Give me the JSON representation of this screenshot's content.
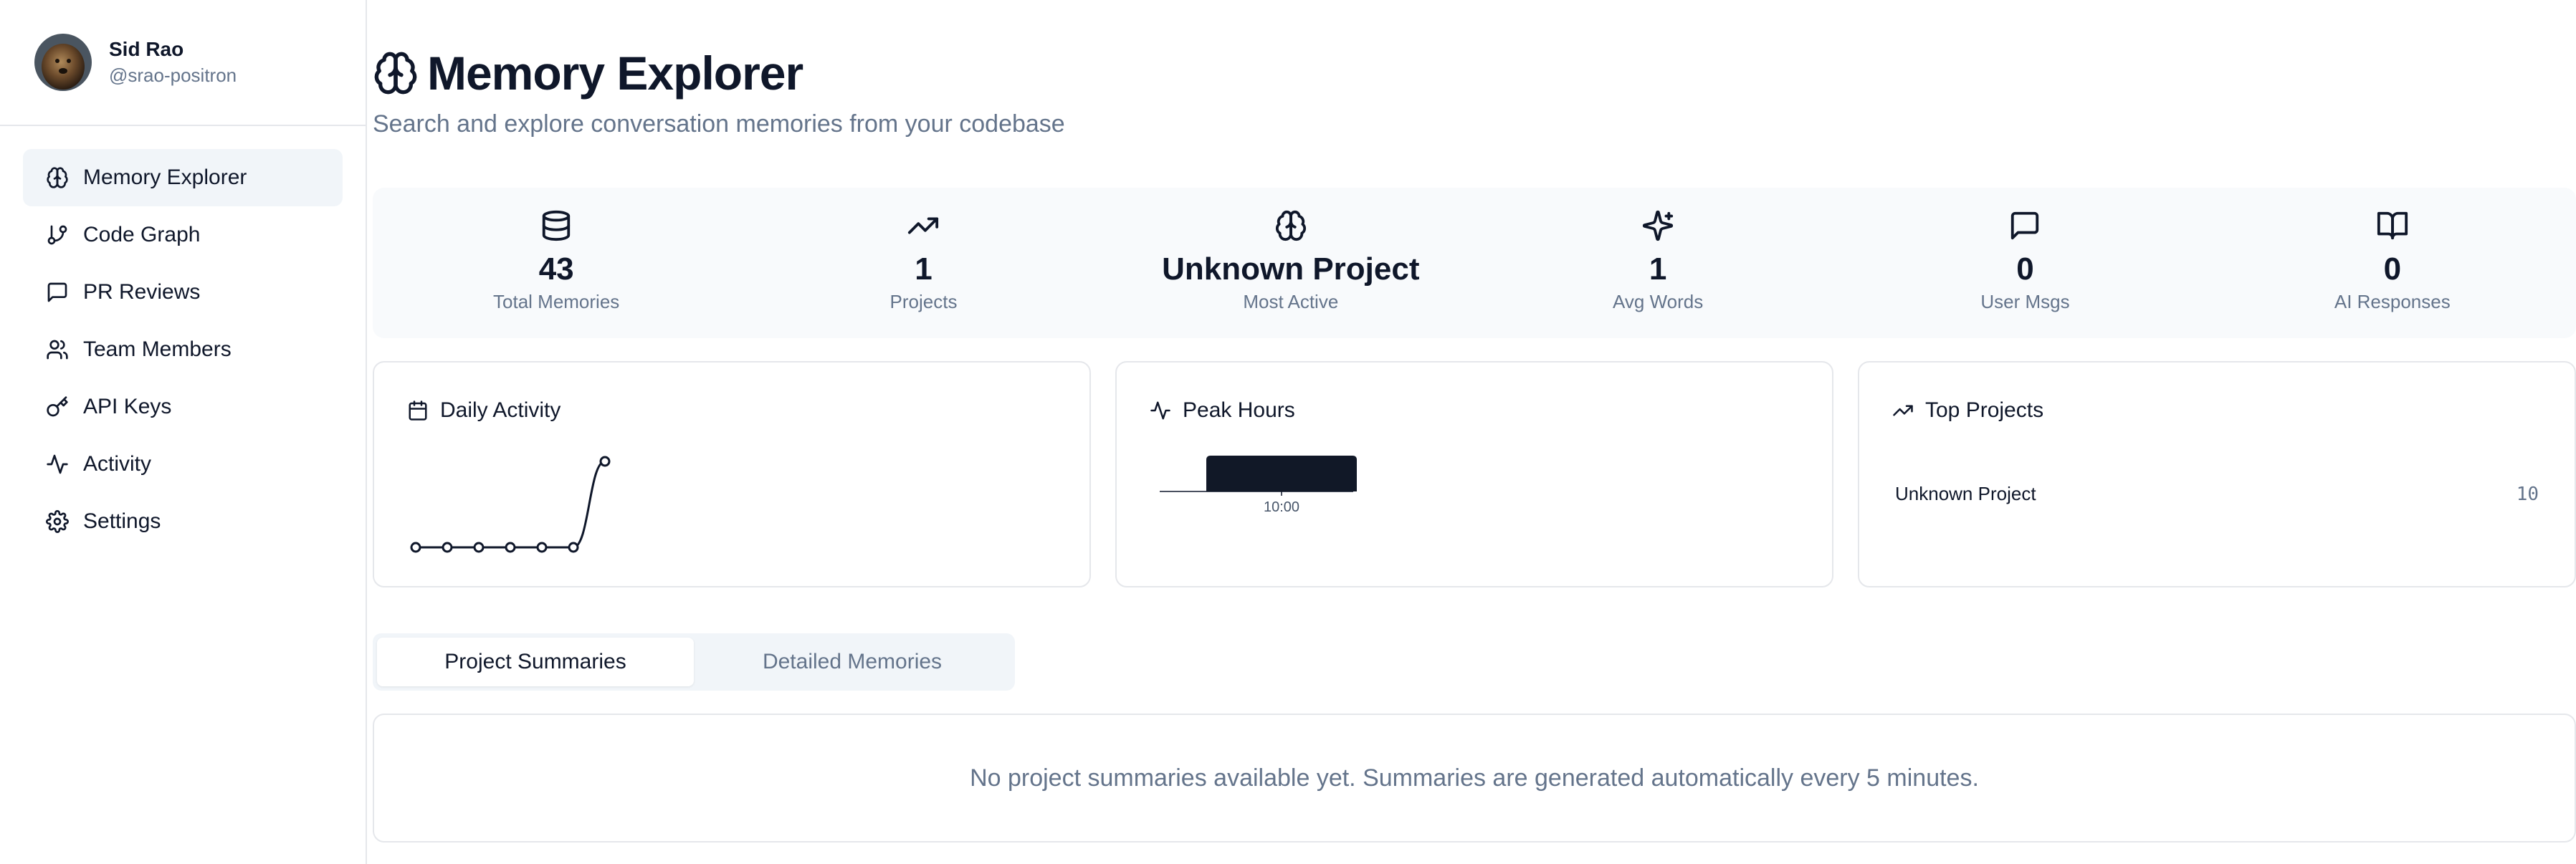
{
  "user": {
    "name": "Sid Rao",
    "handle": "@srao-positron"
  },
  "nav": [
    {
      "label": "Memory Explorer",
      "icon": "brain-icon",
      "active": true
    },
    {
      "label": "Code Graph",
      "icon": "git-branch-icon"
    },
    {
      "label": "PR Reviews",
      "icon": "message-square-icon"
    },
    {
      "label": "Team Members",
      "icon": "users-icon"
    },
    {
      "label": "API Keys",
      "icon": "key-icon"
    },
    {
      "label": "Activity",
      "icon": "activity-icon"
    },
    {
      "label": "Settings",
      "icon": "settings-icon"
    }
  ],
  "page": {
    "title": "Memory Explorer",
    "subtitle": "Search and explore conversation memories from your codebase"
  },
  "stats": [
    {
      "value": "43",
      "label": "Total Memories",
      "icon": "database-icon"
    },
    {
      "value": "1",
      "label": "Projects",
      "icon": "trending-up-icon"
    },
    {
      "value": "Unknown Project",
      "label": "Most Active",
      "icon": "brain-icon"
    },
    {
      "value": "1",
      "label": "Avg Words",
      "icon": "sparkles-icon"
    },
    {
      "value": "0",
      "label": "User Msgs",
      "icon": "message-square-icon"
    },
    {
      "value": "0",
      "label": "AI Responses",
      "icon": "book-open-icon"
    }
  ],
  "cards": {
    "daily_activity": {
      "title": "Daily Activity",
      "icon": "calendar-icon"
    },
    "peak_hours": {
      "title": "Peak Hours",
      "icon": "activity-icon",
      "tick_label": "10:00"
    },
    "top_projects": {
      "title": "Top Projects",
      "icon": "trending-up-icon",
      "items": [
        {
          "name": "Unknown Project",
          "count": "10"
        }
      ]
    }
  },
  "chart_data": [
    {
      "type": "line",
      "title": "Daily Activity",
      "x": [
        1,
        2,
        3,
        4,
        5,
        6,
        7
      ],
      "values": [
        0,
        0,
        0,
        0,
        0,
        0,
        43
      ]
    },
    {
      "type": "bar",
      "title": "Peak Hours",
      "categories": [
        "10:00"
      ],
      "values": [
        43
      ]
    }
  ],
  "tabs": [
    {
      "label": "Project Summaries",
      "active": true
    },
    {
      "label": "Detailed Memories",
      "active": false
    }
  ],
  "empty_message": "No project summaries available yet. Summaries are generated automatically every 5 minutes."
}
